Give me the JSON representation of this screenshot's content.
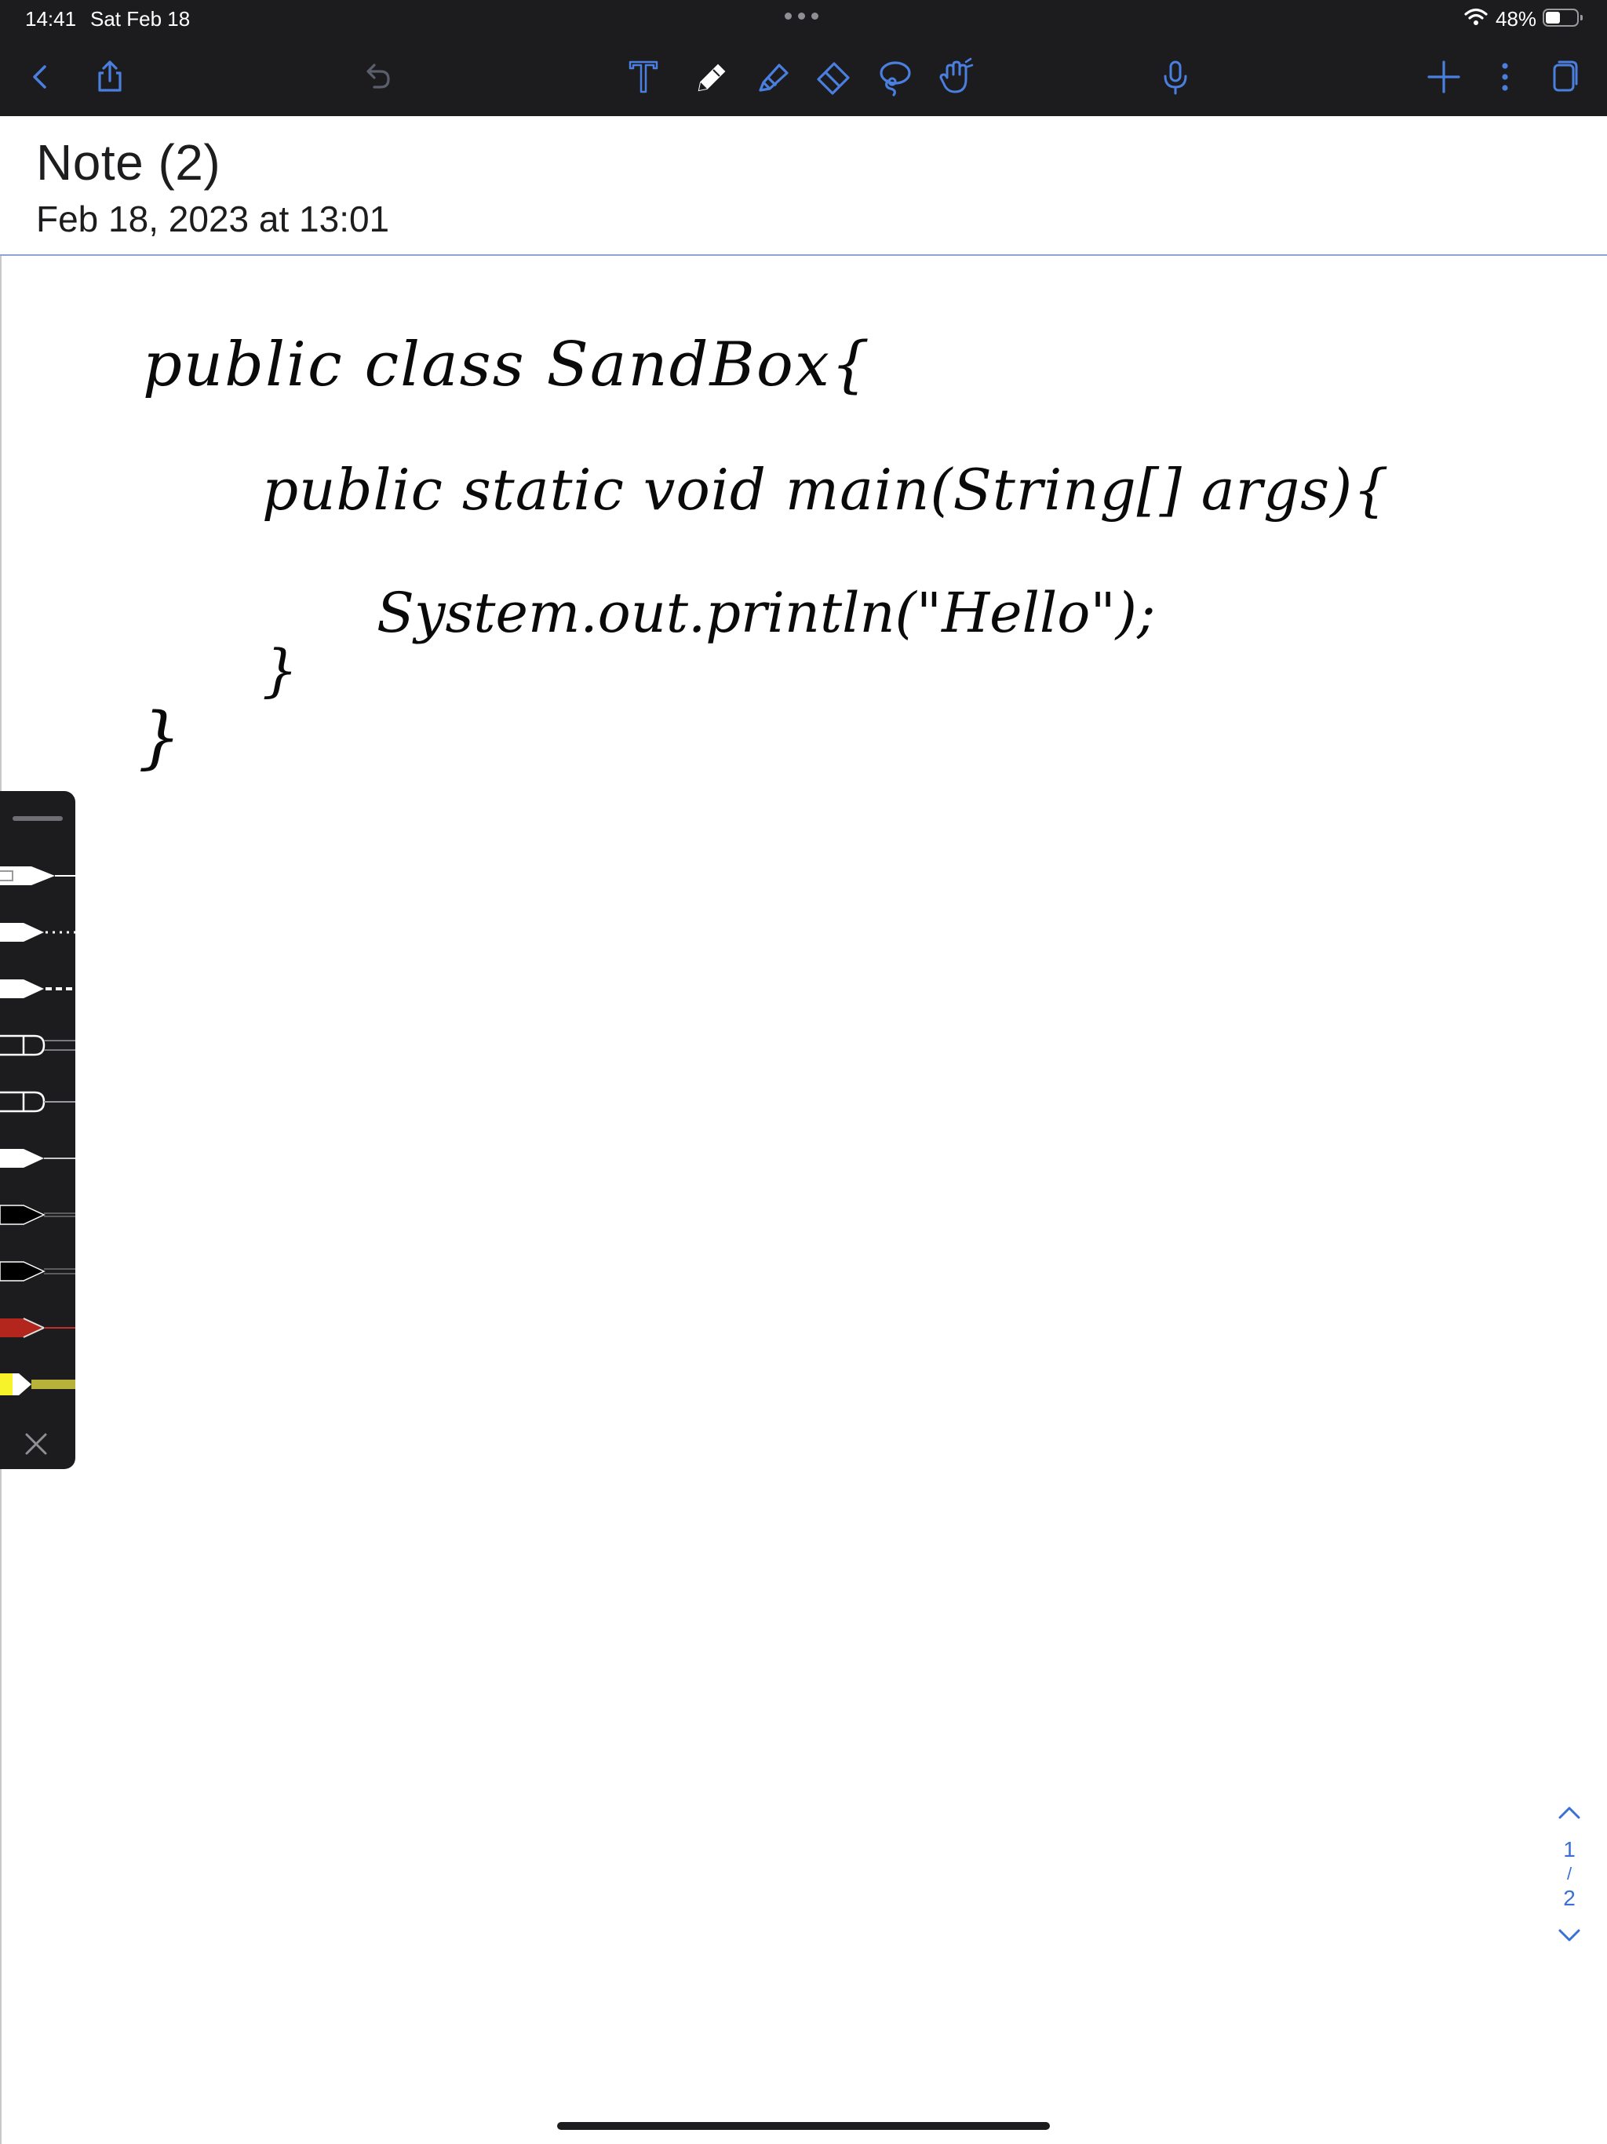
{
  "status_bar": {
    "time": "14:41",
    "date": "Sat Feb 18",
    "battery_percent": "48%",
    "battery_level": 0.48
  },
  "toolbar": {
    "left": [
      {
        "name": "back",
        "icon": "chevron-left-icon"
      },
      {
        "name": "share",
        "icon": "share-icon"
      },
      {
        "name": "undo",
        "icon": "undo-icon"
      }
    ],
    "tools": [
      {
        "name": "text",
        "icon": "text-tool-icon"
      },
      {
        "name": "pen",
        "icon": "pen-tool-icon",
        "selected": true
      },
      {
        "name": "highlighter",
        "icon": "highlighter-icon"
      },
      {
        "name": "eraser",
        "icon": "eraser-icon"
      },
      {
        "name": "lasso",
        "icon": "lasso-icon"
      },
      {
        "name": "hand",
        "icon": "hand-pointer-icon"
      }
    ],
    "right": [
      {
        "name": "microphone",
        "icon": "microphone-icon"
      },
      {
        "name": "add",
        "icon": "plus-icon"
      },
      {
        "name": "more",
        "icon": "more-vertical-icon"
      },
      {
        "name": "pages",
        "icon": "pages-icon"
      }
    ],
    "accent_color": "#4a7fe0"
  },
  "note": {
    "title": "Note (2)",
    "date": "Feb 18, 2023 at 13:01"
  },
  "handwriting": {
    "line1": "public class SandBox{",
    "line2": "public static void main(String[] args){",
    "line3": "System.out.println(\"Hello\");",
    "brace_inner": "}",
    "brace_outer": "}"
  },
  "pen_palette": {
    "pens": [
      {
        "type": "fountain-pen-outline",
        "color": "#ffffff"
      },
      {
        "type": "dotted-pen",
        "color": "#ffffff"
      },
      {
        "type": "dashed-pen",
        "color": "#ffffff"
      },
      {
        "type": "ballpoint-outline",
        "color": "#ffffff"
      },
      {
        "type": "ballpoint-outline",
        "color": "#ffffff"
      },
      {
        "type": "fine-pen",
        "color": "#ffffff"
      },
      {
        "type": "fine-pen",
        "color": "#000000"
      },
      {
        "type": "fine-pen",
        "color": "#000000"
      },
      {
        "type": "fine-pen",
        "color": "#b3261e"
      },
      {
        "type": "highlighter",
        "color": "#f7f32a"
      }
    ]
  },
  "pager": {
    "current": "1",
    "separator": "/",
    "total": "2"
  }
}
